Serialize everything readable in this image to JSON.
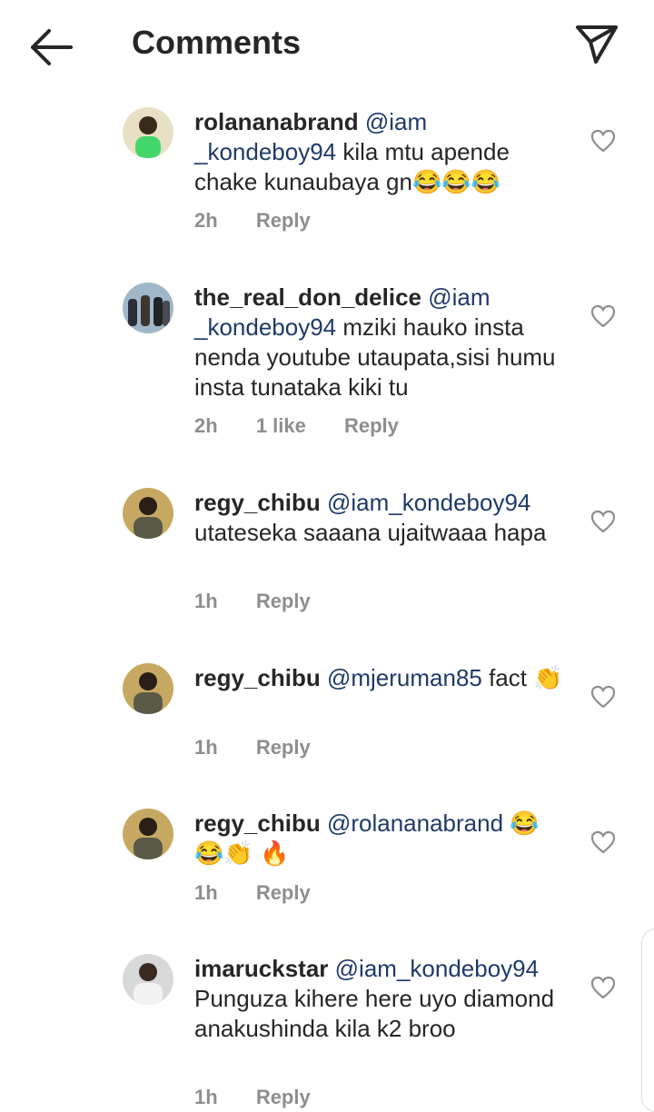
{
  "header": {
    "title": "Comments",
    "back_icon": "arrow-left-icon",
    "share_icon": "send-icon"
  },
  "comments": [
    {
      "user": "rolananabrand",
      "mention": "@iam _kondeboy94",
      "text": " kila mtu apende chake kunaubaya gn😂😂😂",
      "time": "2h",
      "likes": "",
      "reply": "Reply"
    },
    {
      "user": "the_real_don_delice",
      "mention": "@iam _kondeboy94",
      "text": " mziki hauko insta nenda youtube utaupata,sisi humu insta tunataka kiki tu",
      "time": "2h",
      "likes": "1 like",
      "reply": "Reply"
    },
    {
      "user": "regy_chibu",
      "mention": "@iam_kondeboy94",
      "text": " utateseka saaana ujaitwaaa hapa",
      "time": "1h",
      "likes": "",
      "reply": "Reply"
    },
    {
      "user": "regy_chibu",
      "mention": "@mjeruman85",
      "text": " fact 👏",
      "time": "1h",
      "likes": "",
      "reply": "Reply"
    },
    {
      "user": "regy_chibu",
      "mention": "@rolananabrand",
      "text": " 😂 😂👏 🔥",
      "time": "1h",
      "likes": "",
      "reply": "Reply"
    },
    {
      "user": "imaruckstar",
      "mention": "@iam_kondeboy94",
      "text": " Punguza kihere here  uyo diamond  anakushinda kila k2 broo",
      "time": "1h",
      "likes": "",
      "reply": "Reply"
    }
  ]
}
